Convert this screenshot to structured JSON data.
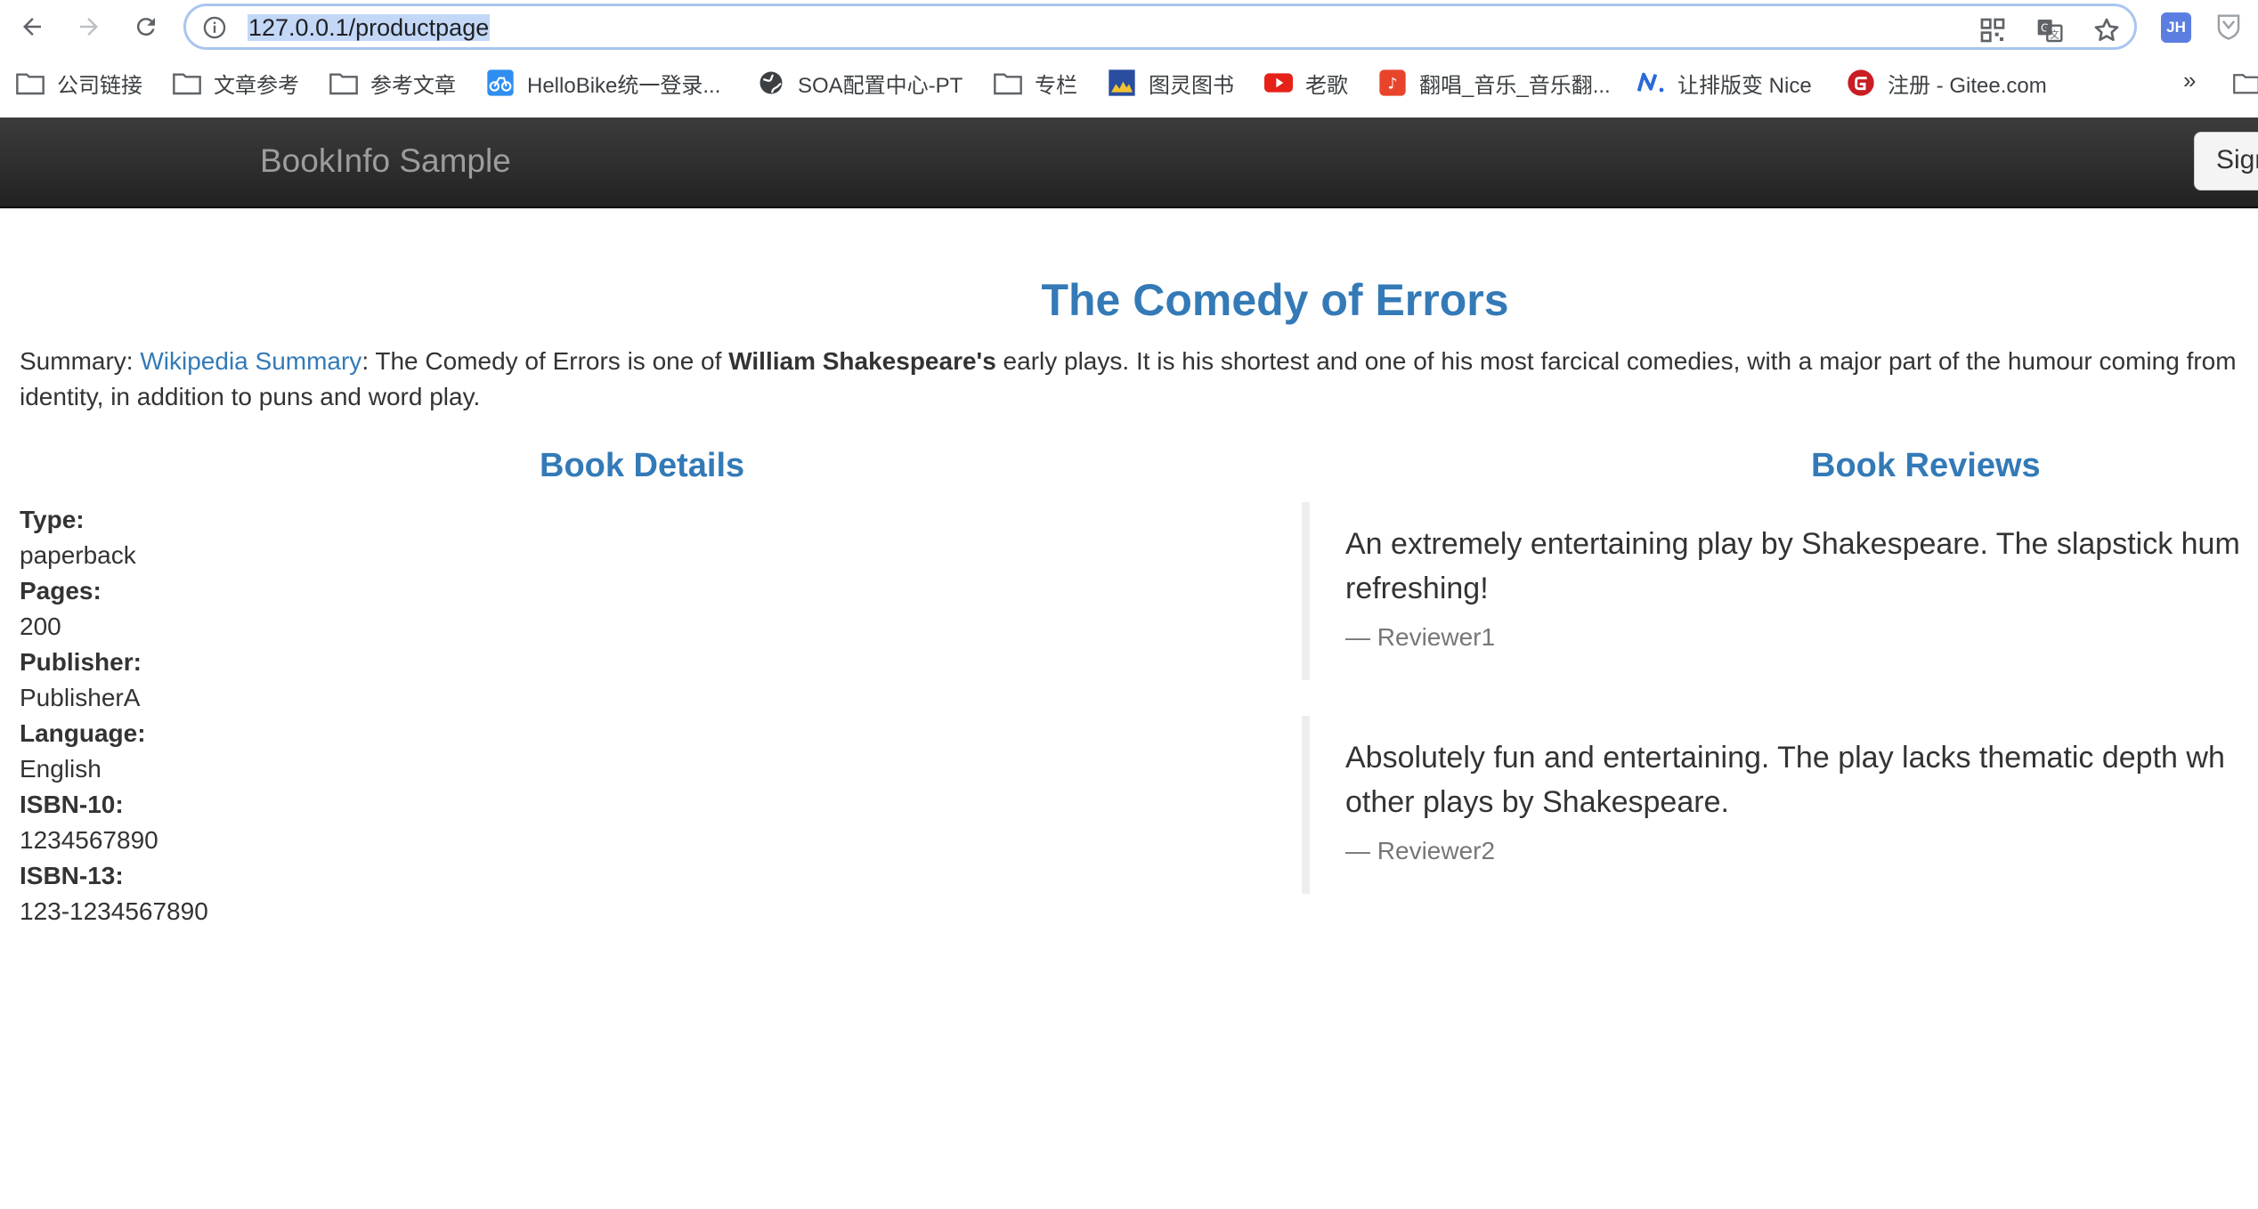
{
  "browser": {
    "url": "127.0.0.1/productpage",
    "profile_initials": "JH",
    "bookmarks": [
      {
        "label": "公司链接",
        "icon": "folder-icon"
      },
      {
        "label": "文章参考",
        "icon": "folder-icon"
      },
      {
        "label": "参考文章",
        "icon": "folder-icon"
      },
      {
        "label": "HelloBike统一登录...",
        "icon": "bike-icon"
      },
      {
        "label": "SOA配置中心-PT",
        "icon": "globe-icon"
      },
      {
        "label": "专栏",
        "icon": "folder-icon"
      },
      {
        "label": "图灵图书",
        "icon": "turing-icon"
      },
      {
        "label": "老歌",
        "icon": "youtube-icon"
      },
      {
        "label": "翻唱_音乐_音乐翻...",
        "icon": "music-icon"
      },
      {
        "label": "让排版变 Nice",
        "icon": "nice-icon"
      },
      {
        "label": "注册 - Gitee.com",
        "icon": "gitee-icon"
      }
    ],
    "more_label": "»"
  },
  "app": {
    "brand": "BookInfo Sample",
    "signin_label": "Sign"
  },
  "product": {
    "title": "The Comedy of Errors",
    "summary_label": "Summary: ",
    "summary_link": "Wikipedia Summary",
    "summary_text_1": ": The Comedy of Errors is one of ",
    "summary_bold": "William Shakespeare's",
    "summary_text_2": " early plays. It is his shortest and one of his most farcical comedies, with a major part of the humour coming from",
    "summary_line2": "identity, in addition to puns and word play."
  },
  "details": {
    "heading": "Book Details",
    "fields": [
      {
        "label": "Type:",
        "value": "paperback"
      },
      {
        "label": "Pages:",
        "value": "200"
      },
      {
        "label": "Publisher:",
        "value": "PublisherA"
      },
      {
        "label": "Language:",
        "value": "English"
      },
      {
        "label": "ISBN-10:",
        "value": "1234567890"
      },
      {
        "label": "ISBN-13:",
        "value": "123-1234567890"
      }
    ]
  },
  "reviews": {
    "heading": "Book Reviews",
    "items": [
      {
        "line1": "An extremely entertaining play by Shakespeare. The slapstick hum",
        "line2": "refreshing!",
        "author": "— Reviewer1"
      },
      {
        "line1": "Absolutely fun and entertaining. The play lacks thematic depth wh",
        "line2": "other plays by Shakespeare.",
        "author": "— Reviewer2"
      }
    ]
  },
  "colors": {
    "link": "#337ab7",
    "navbar": "#222222",
    "brand": "#9d9d9d",
    "url_selection": "#c3d8f7"
  }
}
